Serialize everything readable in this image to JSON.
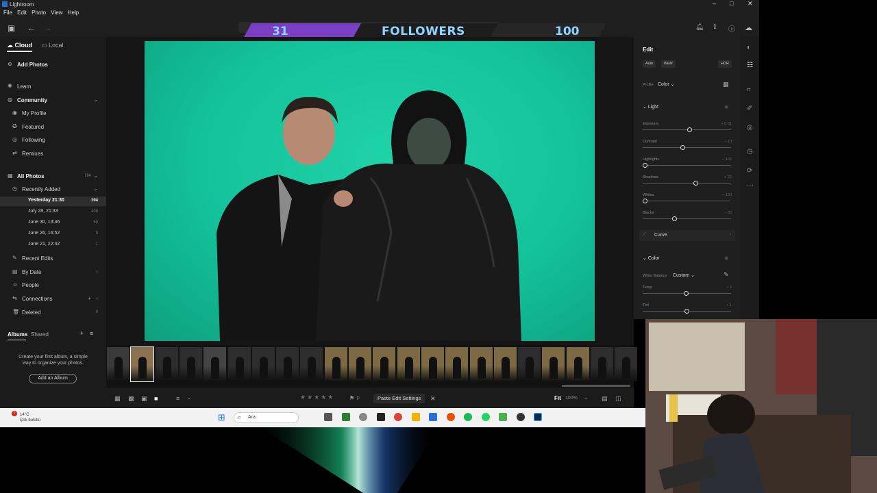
{
  "window": {
    "title": "Lightroom",
    "controls": [
      "–",
      "□",
      "✕"
    ]
  },
  "menu": [
    "File",
    "Edit",
    "Photo",
    "View",
    "Help"
  ],
  "overlay": {
    "left_count": "31",
    "label": "FOLLOWERS",
    "right_count": "100",
    "left_color": "#7b3fc4",
    "text_color": "#8fd3ff"
  },
  "left": {
    "tabs": {
      "cloud": "Cloud",
      "local": "Local"
    },
    "add_photos": "Add Photos",
    "learn": "Learn",
    "community": "Community",
    "community_items": [
      "My Profile",
      "Featured",
      "Following",
      "Remixes"
    ],
    "all_photos": "All Photos",
    "all_photos_count": "784",
    "recently_added": "Recently Added",
    "recent_items": [
      {
        "label": "Yesterday 21:30",
        "count": "104"
      },
      {
        "label": "July 28, 21:33",
        "count": "408"
      },
      {
        "label": "June 30, 13:46",
        "count": "50"
      },
      {
        "label": "June 26, 16:52",
        "count": "8"
      },
      {
        "label": "June 21, 22:42",
        "count": "1"
      }
    ],
    "recent_edits": "Recent Edits",
    "by_date": "By Date",
    "people": "People",
    "connections": "Connections",
    "deleted": "Deleted",
    "deleted_count": "0",
    "albums_tabs": {
      "albums": "Albums",
      "shared": "Shared"
    },
    "albums_hint": "Create your first album, a simple way to organize your photos.",
    "add_album": "Add an Album"
  },
  "bottom": {
    "paste": "Paste Edit Settings",
    "fit": "Fit",
    "zoom": "100%"
  },
  "edit": {
    "title": "Edit",
    "buttons": {
      "auto": "Auto",
      "bw": "B&W",
      "hdr": "HDR"
    },
    "profile_label": "Profile",
    "profile_value": "Color",
    "light": "Light",
    "sliders": [
      {
        "label": "Exposure",
        "value": "+ 0.51",
        "pos": 0.53
      },
      {
        "label": "Contrast",
        "value": "– 10",
        "pos": 0.45
      },
      {
        "label": "Highlights",
        "value": "– 100",
        "pos": 0.0
      },
      {
        "label": "Shadows",
        "value": "+ 22",
        "pos": 0.61
      },
      {
        "label": "Whites",
        "value": "– 100",
        "pos": 0.0
      },
      {
        "label": "Blacks",
        "value": "– 30",
        "pos": 0.35
      }
    ],
    "curve": "Curve",
    "color": "Color",
    "wb_label": "White Balance",
    "wb_value": "Custom",
    "color_sliders": [
      {
        "label": "Temp",
        "value": "– 3",
        "pos": 0.49
      },
      {
        "label": "Tint",
        "value": "+ 1",
        "pos": 0.5
      }
    ]
  },
  "taskbar": {
    "temp": "14°C",
    "weather": "Çok bulutlu",
    "notif": "1",
    "search": "Ara"
  }
}
